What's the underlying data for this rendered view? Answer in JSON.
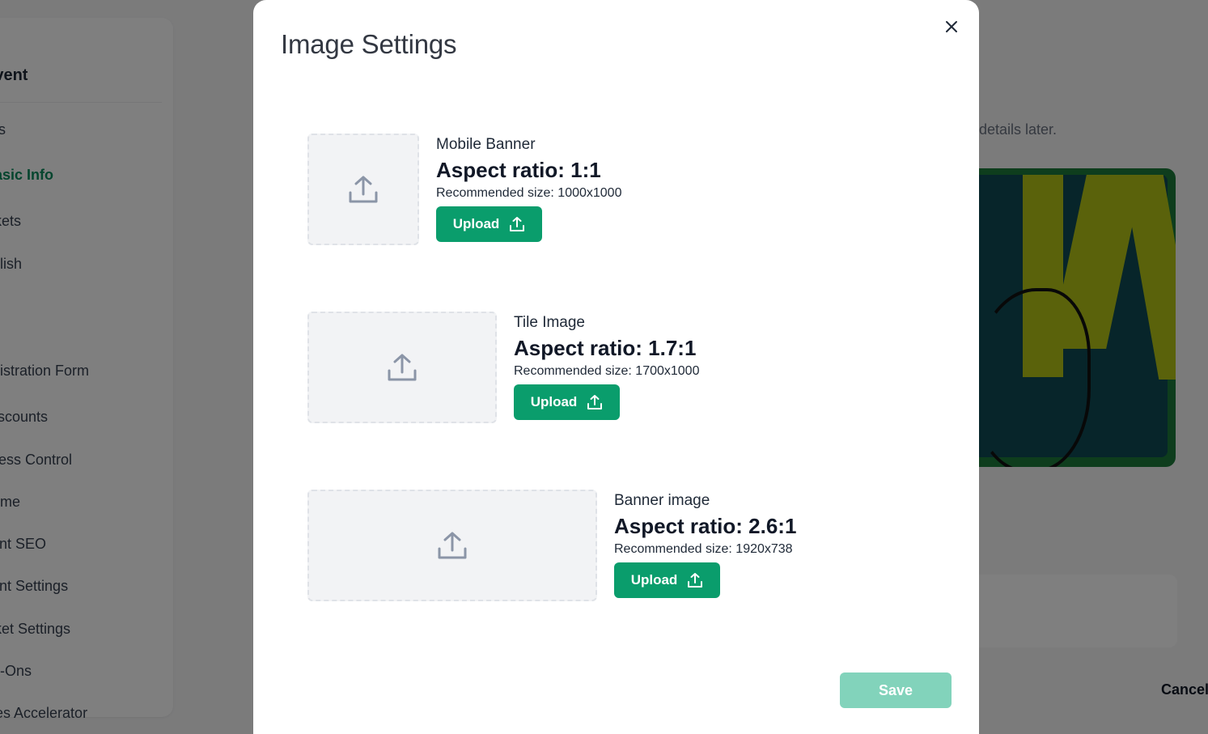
{
  "background": {
    "sidebar": {
      "title": "Event",
      "items": [
        "ails",
        "Basic Info",
        "ickets",
        "ublish",
        "egistration Form",
        "Discounts",
        "ccess Control",
        "heme",
        "vent SEO",
        "vent Settings",
        "icket Settings",
        "dd-Ons",
        "ales Accelerator"
      ],
      "active_item": "Basic Info"
    },
    "hint_text": "details later.",
    "cancel_label": "Cancel"
  },
  "modal": {
    "title": "Image Settings",
    "close_icon": "close-icon",
    "sections": [
      {
        "label": "Mobile Banner",
        "aspect_ratio": "Aspect ratio: 1:1",
        "recommended": "Recommended size: 1000x1000",
        "upload_label": "Upload"
      },
      {
        "label": "Tile Image",
        "aspect_ratio": "Aspect ratio: 1.7:1",
        "recommended": "Recommended size: 1700x1000",
        "upload_label": "Upload"
      },
      {
        "label": "Banner image",
        "aspect_ratio": "Aspect ratio: 2.6:1",
        "recommended": "Recommended size: 1920x738",
        "upload_label": "Upload"
      }
    ],
    "save_label": "Save"
  },
  "colors": {
    "accent": "#0a9d6c",
    "accent_disabled": "#82d3bb",
    "active_nav": "#0a8a5c"
  }
}
